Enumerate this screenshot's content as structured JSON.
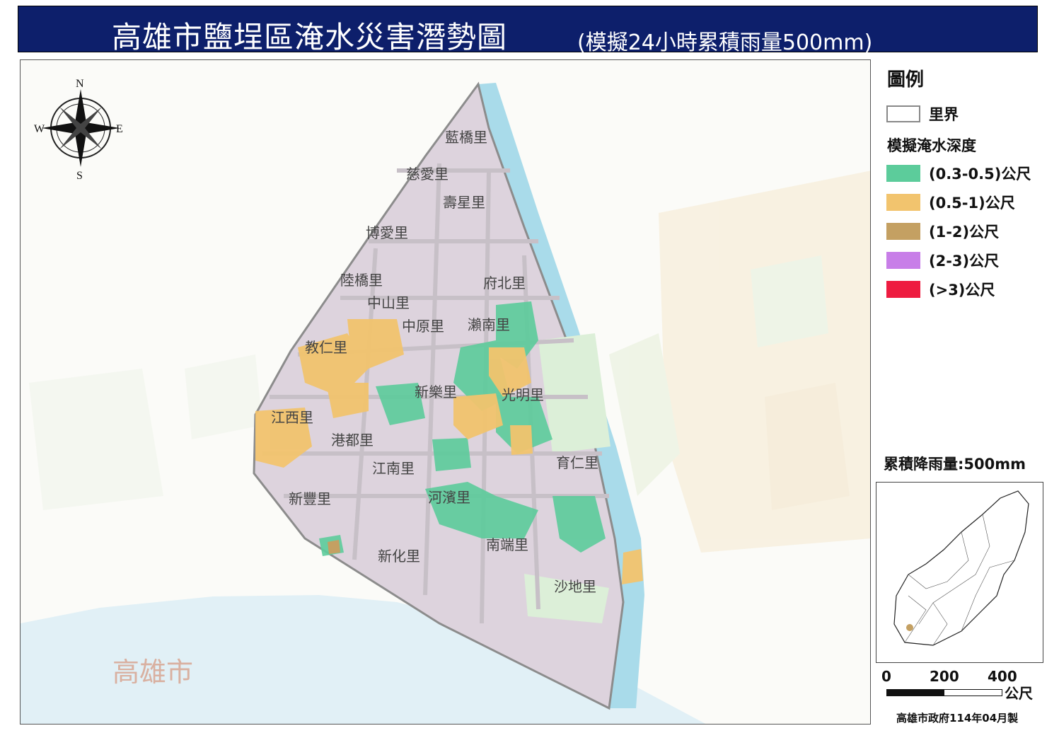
{
  "title": {
    "main": "高雄市鹽埕區淹水災害潛勢圖",
    "sub": "(模擬24小時累積雨量500mm)"
  },
  "compass": {
    "n": "N",
    "s": "S",
    "e": "E",
    "w": "W"
  },
  "villages": [
    "藍橋里",
    "慈愛里",
    "壽星里",
    "博愛里",
    "府北里",
    "陸橋里",
    "中山里",
    "中原里",
    "瀨南里",
    "教仁里",
    "新樂里",
    "光明里",
    "江西里",
    "港都里",
    "江南里",
    "育仁里",
    "新豐里",
    "河濱里",
    "南端里",
    "新化里",
    "沙地里"
  ],
  "city_label": "高雄市",
  "legend": {
    "title": "圖例",
    "boundary_label": "里界",
    "depth_title": "模擬淹水深度",
    "items": [
      {
        "label": "(0.3-0.5)公尺",
        "color": "#5ccc9b"
      },
      {
        "label": "(0.5-1)公尺",
        "color": "#f2c46e"
      },
      {
        "label": "(1-2)公尺",
        "color": "#c4a062"
      },
      {
        "label": "(2-3)公尺",
        "color": "#c87ee8"
      },
      {
        "label": "(>3)公尺",
        "color": "#ee1c40"
      }
    ]
  },
  "rainfall": "累積降雨量:500mm",
  "scale": {
    "ticks": [
      "0",
      "200",
      "400"
    ],
    "unit": "公尺"
  },
  "credit": "高雄市政府114年04月製",
  "colors": {
    "title_bg": "#0d1f6b",
    "district": "#ddd3dd",
    "river": "#a9dbea",
    "park": "#dcefd8",
    "boundary": "#8c8c8c"
  }
}
